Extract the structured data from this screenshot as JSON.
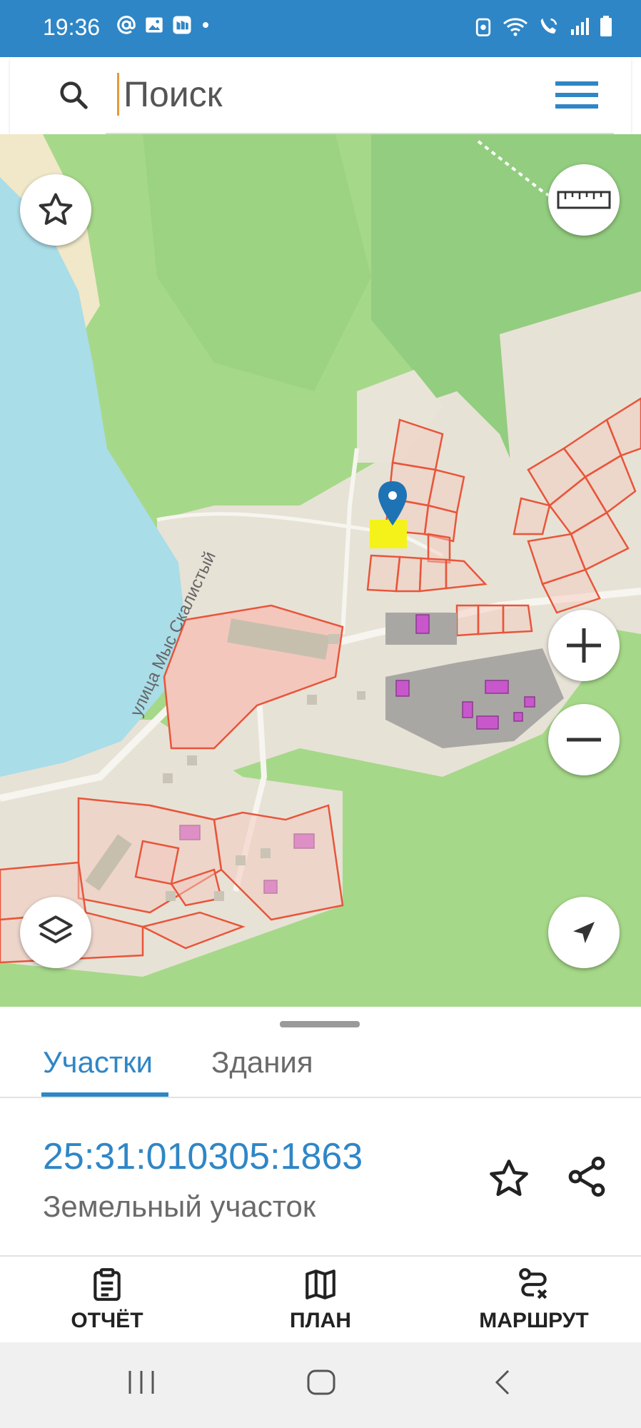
{
  "status_bar": {
    "time": "19:36",
    "left_icons": [
      "at-sign-icon",
      "gallery-icon",
      "app-icon",
      "dot-icon"
    ],
    "right_icons": [
      "alarm-icon",
      "wifi-icon",
      "wifi-call-icon",
      "signal-icon",
      "battery-icon"
    ]
  },
  "search": {
    "placeholder": "Поиск"
  },
  "map": {
    "road_label": "улица Мыс Скалистый",
    "buttons": [
      "star-icon",
      "ruler-icon",
      "zoom-in-icon",
      "zoom-out-icon",
      "layers-icon",
      "locate-icon"
    ]
  },
  "tabs": [
    {
      "label": "Участки",
      "active": true
    },
    {
      "label": "Здания",
      "active": false
    }
  ],
  "parcel": {
    "number": "25:31:010305:1863",
    "type": "Земельный участок"
  },
  "actions": [
    {
      "label": "ОТЧЁТ",
      "icon": "clipboard-icon"
    },
    {
      "label": "ПЛАН",
      "icon": "map-icon"
    },
    {
      "label": "МАРШРУТ",
      "icon": "route-icon"
    }
  ],
  "colors": {
    "accent": "#2f86c6",
    "water": "#a9dde8",
    "forest": "#9fd27f",
    "parcel_fill": "#f4c7bd",
    "parcel_stroke": "#e8553a",
    "building": "#c957cc",
    "selected": "#f5f21a"
  }
}
